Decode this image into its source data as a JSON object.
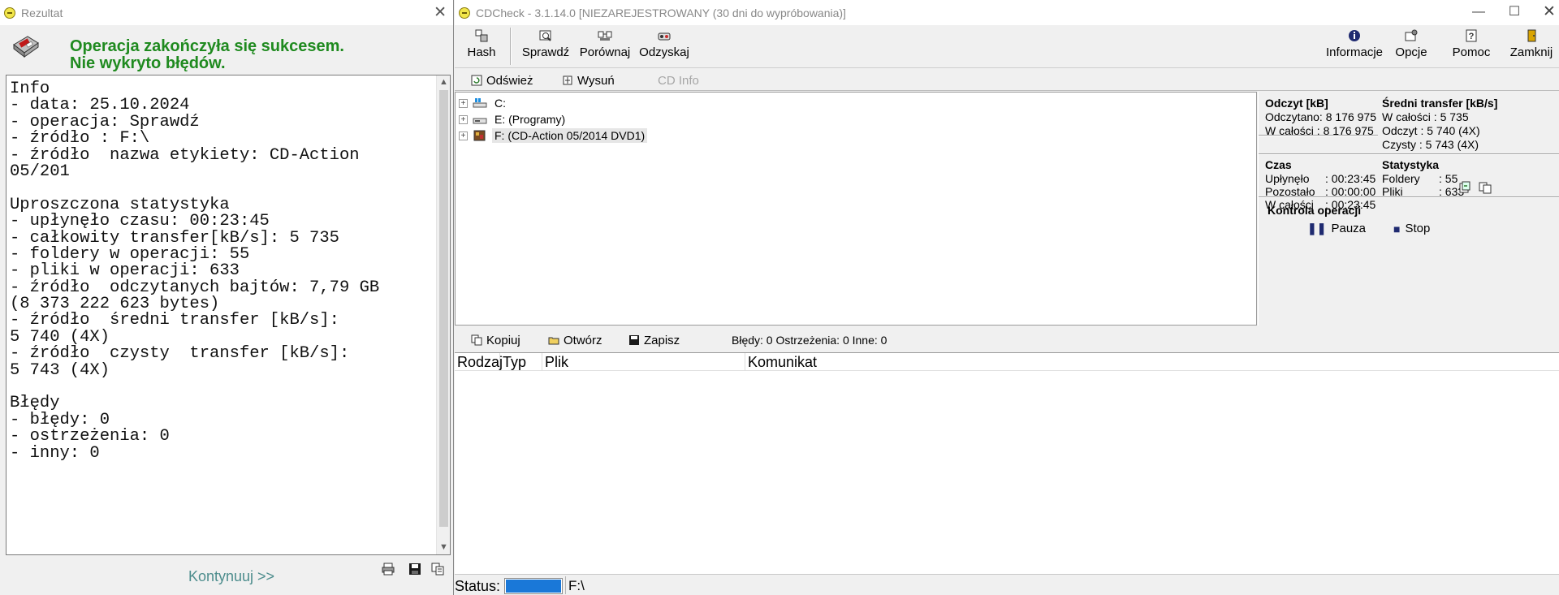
{
  "result_dialog": {
    "title": "Rezultat",
    "close_glyph": "✕",
    "success_line_1": "Operacja zakończyła się sukcesem.",
    "success_line_2": "Nie wykryto błędów.",
    "text_lines": [
      "Info",
      "- data: 25.10.2024",
      "- operacja: Sprawdź",
      "- źródło : F:\\",
      "- źródło  nazwa etykiety: CD-Action",
      "05/201",
      "",
      "Uproszczona statystyka",
      "- upłynęło czasu: 00:23:45",
      "- całkowity transfer[kB/s]: 5 735",
      "- foldery w operacji: 55",
      "- pliki w operacji: 633",
      "- źródło  odczytanych bajtów: 7,79 GB",
      "(8 373 222 623 bytes)",
      "- źródło  średni transfer [kB/s]:",
      "5 740 (4X)",
      "- źródło  czysty  transfer [kB/s]:",
      "5 743 (4X)",
      "",
      "Błędy",
      "- błędy: 0",
      "- ostrzeżenia: 0",
      "- inny: 0"
    ],
    "continue_label": "Kontynuuj >>",
    "icons": [
      "disk-icon",
      "print-icon",
      "save-icon",
      "copy-icon"
    ]
  },
  "main_window": {
    "title": "CDCheck - 3.1.14.0 [NIEZAREJESTROWANY (30 dni do wypróbowania)]",
    "window_buttons": {
      "minimize": "—",
      "maximize": "☐",
      "close": "✕"
    },
    "toolbar": {
      "hash": "Hash",
      "check": "Sprawdź",
      "compare": "Porównaj",
      "recover": "Odzyskaj",
      "info": "Informacje",
      "options": "Opcje",
      "help": "Pomoc",
      "close": "Zamknij"
    },
    "subtoolbar": {
      "refresh": "Odśwież",
      "eject": "Wysuń",
      "cd_info": "CD Info"
    },
    "tree": [
      {
        "label": "C:",
        "icon": "windows-drive-icon"
      },
      {
        "label": "E: (Programy)",
        "icon": "drive-icon"
      },
      {
        "label": "F: (CD-Action 05/2014 DVD1)",
        "icon": "dvd-drive-icon"
      }
    ],
    "stats": {
      "read_header": "Odczyt [kB]",
      "read_rows": [
        "Odczytano: 8 176 975",
        "W całości  : 8 176 975"
      ],
      "avg_header": "Średni transfer [kB/s]",
      "avg_rows": [
        "W całości : 5 735",
        "Odczyt     : 5 740 (4X)",
        "Czysty      : 5 743 (4X)"
      ],
      "time_header": "Czas",
      "time_rows": [
        {
          "label": "Upłynęło",
          "value": ": 00:23:45"
        },
        {
          "label": "Pozostało",
          "value": ": 00:00:00"
        },
        {
          "label": "W całości",
          "value": ": 00:23:45"
        }
      ],
      "stats_header": "Statystyka",
      "stats_rows": [
        {
          "label": "Foldery",
          "value": ": 55"
        },
        {
          "label": "Pliki",
          "value": ": 633"
        }
      ],
      "control_header": "Kontrola operacji",
      "pause": "Pauza",
      "stop": "Stop"
    },
    "log_toolbar": {
      "copy": "Kopiuj",
      "open": "Otwórz",
      "save": "Zapisz",
      "summary": "Błędy: 0 Ostrzeżenia: 0 Inne: 0"
    },
    "log_columns": [
      "Rodzaj",
      "Typ",
      "Plik",
      "Komunikat"
    ],
    "status": {
      "label": "Status:",
      "progress": 1.0,
      "path": "F:\\",
      "progress_color": "#1a78d8"
    }
  },
  "colors": {
    "success_green": "#1f8a1f",
    "continue_teal": "#4d8d8d",
    "control_navy": "#1f2a70"
  }
}
